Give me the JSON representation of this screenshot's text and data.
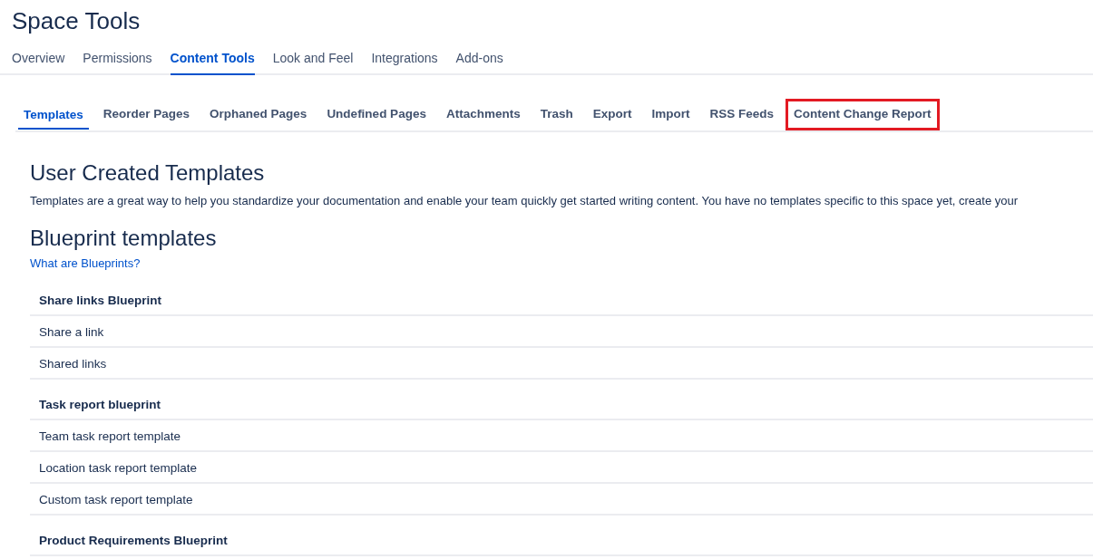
{
  "title": "Space Tools",
  "tabs": [
    {
      "label": "Overview",
      "selected": false
    },
    {
      "label": "Permissions",
      "selected": false
    },
    {
      "label": "Content Tools",
      "selected": true
    },
    {
      "label": "Look and Feel",
      "selected": false
    },
    {
      "label": "Integrations",
      "selected": false
    },
    {
      "label": "Add-ons",
      "selected": false
    }
  ],
  "subtabs": [
    {
      "label": "Templates",
      "selected": true,
      "highlighted": false
    },
    {
      "label": "Reorder Pages",
      "selected": false,
      "highlighted": false
    },
    {
      "label": "Orphaned Pages",
      "selected": false,
      "highlighted": false
    },
    {
      "label": "Undefined Pages",
      "selected": false,
      "highlighted": false
    },
    {
      "label": "Attachments",
      "selected": false,
      "highlighted": false
    },
    {
      "label": "Trash",
      "selected": false,
      "highlighted": false
    },
    {
      "label": "Export",
      "selected": false,
      "highlighted": false
    },
    {
      "label": "Import",
      "selected": false,
      "highlighted": false
    },
    {
      "label": "RSS Feeds",
      "selected": false,
      "highlighted": false
    },
    {
      "label": "Content Change Report",
      "selected": false,
      "highlighted": true
    }
  ],
  "user_templates": {
    "heading": "User Created Templates",
    "description": "Templates are a great way to help you standardize your documentation and enable your team quickly get started writing content. You have no templates specific to this space yet, create your"
  },
  "blueprints": {
    "heading": "Blueprint templates",
    "link": "What are Blueprints?",
    "groups": [
      {
        "name": "Share links Blueprint",
        "items": [
          "Share a link",
          "Shared links"
        ]
      },
      {
        "name": "Task report blueprint",
        "items": [
          "Team task report template",
          "Location task report template",
          "Custom task report template"
        ]
      },
      {
        "name": "Product Requirements Blueprint"
      }
    ]
  }
}
